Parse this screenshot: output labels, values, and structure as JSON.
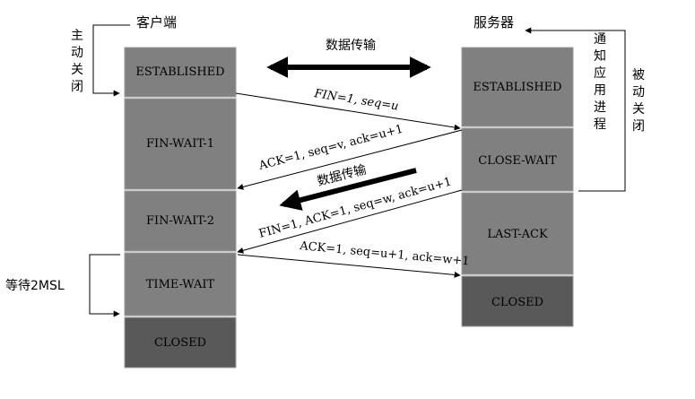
{
  "client": {
    "title": "客户端",
    "states": [
      "ESTABLISHED",
      "FIN-WAIT-1",
      "FIN-WAIT-2",
      "TIME-WAIT",
      "CLOSED"
    ],
    "side_label_active_close": "主动关闭",
    "side_label_wait": "等待2MSL"
  },
  "server": {
    "title": "服务器",
    "states": [
      "ESTABLISHED",
      "CLOSE-WAIT",
      "LAST-ACK",
      "CLOSED"
    ],
    "side_label_notify_app": "通知应用进程",
    "side_label_passive_close": "被动关闭"
  },
  "messages": {
    "data_transfer_top": "数据传输",
    "fin_client": "FIN=1, seq=u",
    "ack_server": "ACK=1, seq=v, ack=u+1",
    "data_transfer_mid": "数据传输",
    "fin_server": "FIN=1, ACK=1, seq=w, ack=u+1",
    "ack_client": "ACK=1, seq=u+1, ack=w+1"
  },
  "colors": {
    "box_fill": "#808080",
    "box_closed_fill": "#595959",
    "box_stroke": "#9a9a9a",
    "line": "#000000",
    "text": "#000000"
  }
}
